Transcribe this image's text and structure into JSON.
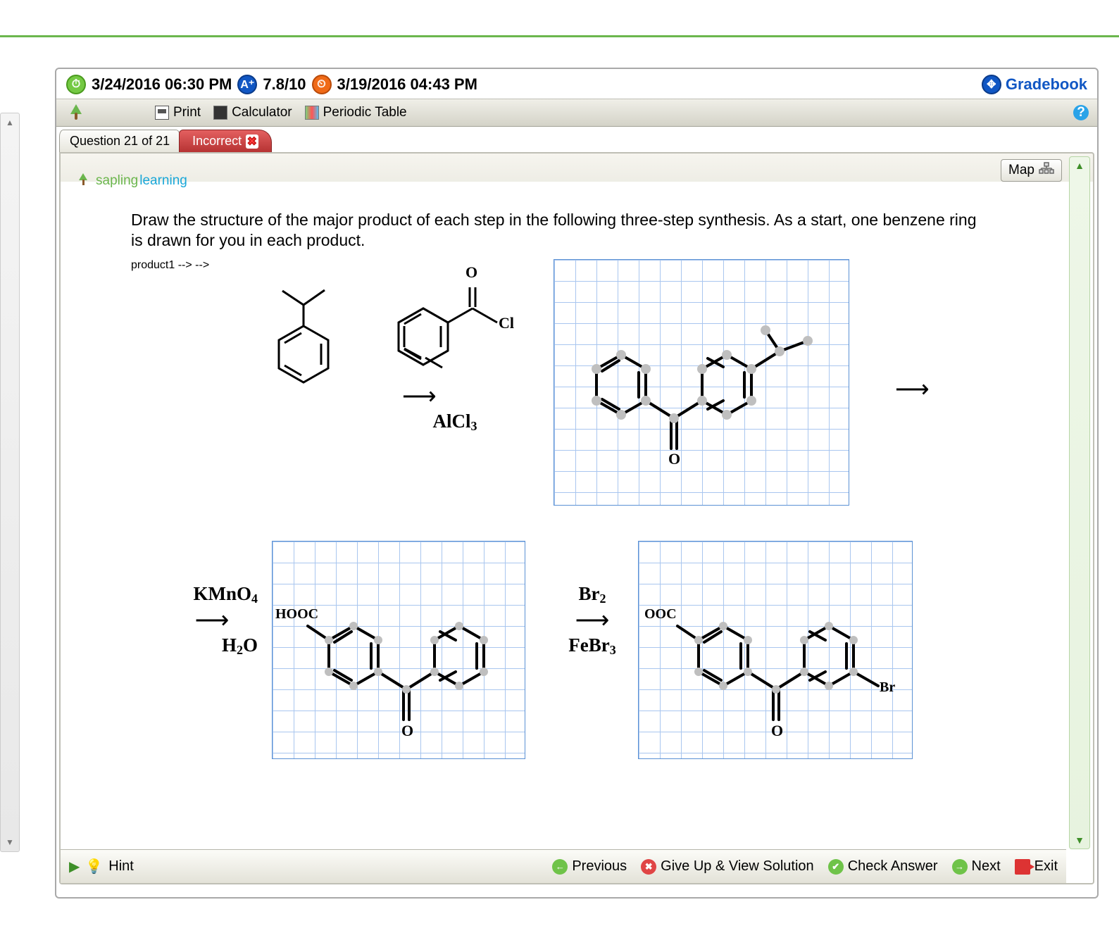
{
  "status": {
    "due_date": "3/24/2016 06:30 PM",
    "grade": "7.8/10",
    "submitted": "3/19/2016 04:43 PM",
    "gradebook_label": "Gradebook"
  },
  "toolbar": {
    "print": "Print",
    "calculator": "Calculator",
    "periodic_table": "Periodic Table"
  },
  "tabs": {
    "question_label": "Question 21 of 21",
    "status_label": "Incorrect"
  },
  "map_label": "Map",
  "brand": {
    "part1": "sapling",
    "part2": "learning"
  },
  "question_text": "Draw the structure of the major product of each step in the following three-step synthesis. As a start, one benzene ring is drawn for you in each product.",
  "reaction": {
    "step1": {
      "reagent_top": "",
      "reagent_bottom": "AlCl",
      "reagent_bottom_sub": "3",
      "acyl_label_o": "O",
      "acyl_label_cl": "Cl"
    },
    "step2": {
      "reagent_top": "KMnO",
      "reagent_top_sub": "4",
      "reagent_bottom": "H",
      "reagent_bottom_sub": "2",
      "reagent_bottom_tail": "O",
      "product_label": "HOOC",
      "product_o": "O"
    },
    "step3": {
      "reagent_top": "Br",
      "reagent_top_sub": "2",
      "reagent_bottom": "FeBr",
      "reagent_bottom_sub": "3",
      "product_label": "OOC",
      "product_br": "Br",
      "product_o": "O"
    }
  },
  "footer": {
    "hint": "Hint",
    "previous": "Previous",
    "give_up": "Give Up & View Solution",
    "check": "Check Answer",
    "next": "Next",
    "exit": "Exit"
  }
}
